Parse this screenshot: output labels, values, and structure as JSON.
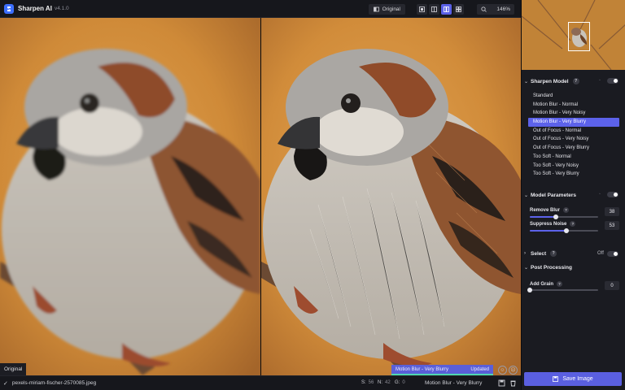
{
  "app": {
    "name": "Sharpen AI",
    "version": "v4.1.0"
  },
  "toolbar": {
    "original_label": "Original",
    "zoom_value": "146%"
  },
  "preview": {
    "original_label": "Original",
    "status_model": "Motion Blur - Very Blurry",
    "status_state": "Updated"
  },
  "footer": {
    "filename": "pexels-miriam-fischer-2570085.jpeg",
    "stats": [
      {
        "key": "S:",
        "value": "56"
      },
      {
        "key": "N:",
        "value": "42"
      },
      {
        "key": "G:",
        "value": "0"
      }
    ],
    "model_label": "Motion Blur - Very Blurry"
  },
  "sidebar": {
    "sharpen_model": {
      "title": "Sharpen Model",
      "toggle_on": true,
      "items": [
        "Standard",
        "Motion Blur - Normal",
        "Motion Blur - Very Noisy",
        "Motion Blur - Very Blurry",
        "Out of Focus - Normal",
        "Out of Focus - Very Noisy",
        "Out of Focus - Very Blurry",
        "Too Soft - Normal",
        "Too Soft - Very Noisy",
        "Too Soft - Very Blurry"
      ],
      "selected_index": 3
    },
    "model_parameters": {
      "title": "Model Parameters",
      "params": [
        {
          "label": "Remove Blur",
          "value": "38",
          "fraction": 0.38
        },
        {
          "label": "Suppress Noise",
          "value": "53",
          "fraction": 0.53
        }
      ]
    },
    "select": {
      "title": "Select",
      "state": "Off"
    },
    "post_processing": {
      "title": "Post Processing",
      "params": [
        {
          "label": "Add Grain",
          "value": "0",
          "fraction": 0.0
        }
      ]
    },
    "save_label": "Save Image"
  },
  "colors": {
    "accent": "#5c62ea",
    "panel": "#1a1b21",
    "background": "#111217",
    "updated_bar": "#4fd8b0"
  }
}
